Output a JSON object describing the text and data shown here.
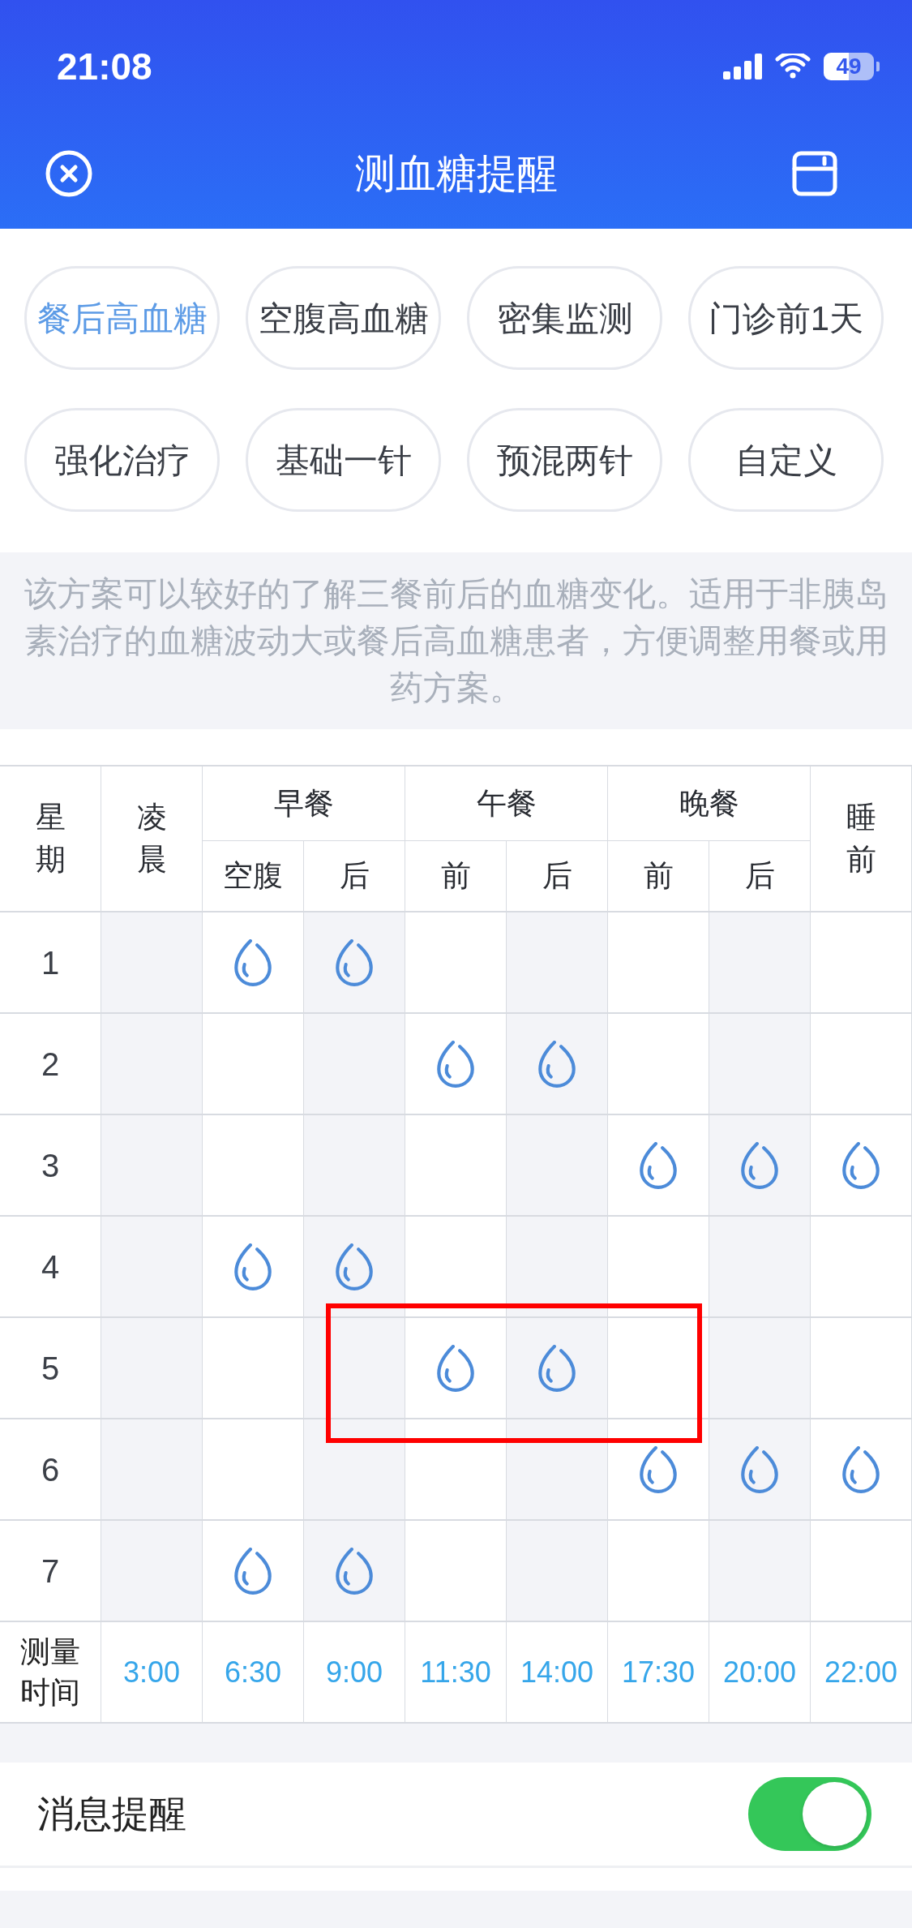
{
  "status_bar": {
    "time": "21:08",
    "battery": "49"
  },
  "nav": {
    "title": "测血糖提醒"
  },
  "plans": [
    {
      "label": "餐后高血糖",
      "selected": true
    },
    {
      "label": "空腹高血糖",
      "selected": false
    },
    {
      "label": "密集监测",
      "selected": false
    },
    {
      "label": "门诊前1天",
      "selected": false
    },
    {
      "label": "强化治疗",
      "selected": false
    },
    {
      "label": "基础一针",
      "selected": false
    },
    {
      "label": "预混两针",
      "selected": false
    },
    {
      "label": "自定义",
      "selected": false
    }
  ],
  "description": "该方案可以较好的了解三餐前后的血糖变化。适用于非胰岛素治疗的血糖波动大或餐后高血糖患者，方便调整用餐或用药方案。",
  "table": {
    "columns": [
      {
        "label": "星期"
      },
      {
        "label": "凌晨"
      },
      {
        "label": "早餐",
        "subcolumns": [
          "空腹",
          "后"
        ]
      },
      {
        "label": "午餐",
        "subcolumns": [
          "前",
          "后"
        ]
      },
      {
        "label": "晚餐",
        "subcolumns": [
          "前",
          "后"
        ]
      },
      {
        "label": "睡前"
      }
    ],
    "rows": [
      {
        "label": "1",
        "cells": [
          {
            "scheduled": false
          },
          {
            "scheduled": true
          },
          {
            "scheduled": true
          },
          {
            "scheduled": false
          },
          {
            "scheduled": false
          },
          {
            "scheduled": false
          },
          {
            "scheduled": false
          },
          {
            "scheduled": false
          }
        ]
      },
      {
        "label": "2",
        "cells": [
          {
            "scheduled": false
          },
          {
            "scheduled": false
          },
          {
            "scheduled": false
          },
          {
            "scheduled": true
          },
          {
            "scheduled": true
          },
          {
            "scheduled": false
          },
          {
            "scheduled": false
          },
          {
            "scheduled": false
          }
        ]
      },
      {
        "label": "3",
        "cells": [
          {
            "scheduled": false
          },
          {
            "scheduled": false
          },
          {
            "scheduled": false
          },
          {
            "scheduled": false
          },
          {
            "scheduled": false
          },
          {
            "scheduled": true
          },
          {
            "scheduled": true
          },
          {
            "scheduled": true
          }
        ]
      },
      {
        "label": "4",
        "cells": [
          {
            "scheduled": false
          },
          {
            "scheduled": true
          },
          {
            "scheduled": true
          },
          {
            "scheduled": false
          },
          {
            "scheduled": false
          },
          {
            "scheduled": false
          },
          {
            "scheduled": false
          },
          {
            "scheduled": false
          }
        ]
      },
      {
        "label": "5",
        "cells": [
          {
            "scheduled": false
          },
          {
            "scheduled": false
          },
          {
            "scheduled": false
          },
          {
            "scheduled": true
          },
          {
            "scheduled": true
          },
          {
            "scheduled": false
          },
          {
            "scheduled": false
          },
          {
            "scheduled": false
          }
        ]
      },
      {
        "label": "6",
        "cells": [
          {
            "scheduled": false
          },
          {
            "scheduled": false
          },
          {
            "scheduled": false
          },
          {
            "scheduled": false
          },
          {
            "scheduled": false
          },
          {
            "scheduled": true
          },
          {
            "scheduled": true
          },
          {
            "scheduled": true
          }
        ]
      },
      {
        "label": "7",
        "cells": [
          {
            "scheduled": false
          },
          {
            "scheduled": true
          },
          {
            "scheduled": true
          },
          {
            "scheduled": false
          },
          {
            "scheduled": false
          },
          {
            "scheduled": false
          },
          {
            "scheduled": false
          },
          {
            "scheduled": false
          }
        ]
      }
    ],
    "time_row": {
      "label": "测量时间",
      "times": [
        "3:00",
        "6:30",
        "9:00",
        "11:30",
        "14:00",
        "17:30",
        "20:00",
        "22:00"
      ]
    },
    "annotation": {
      "kind": "box"
    }
  },
  "reminder": {
    "label": "消息提醒",
    "on": true
  }
}
